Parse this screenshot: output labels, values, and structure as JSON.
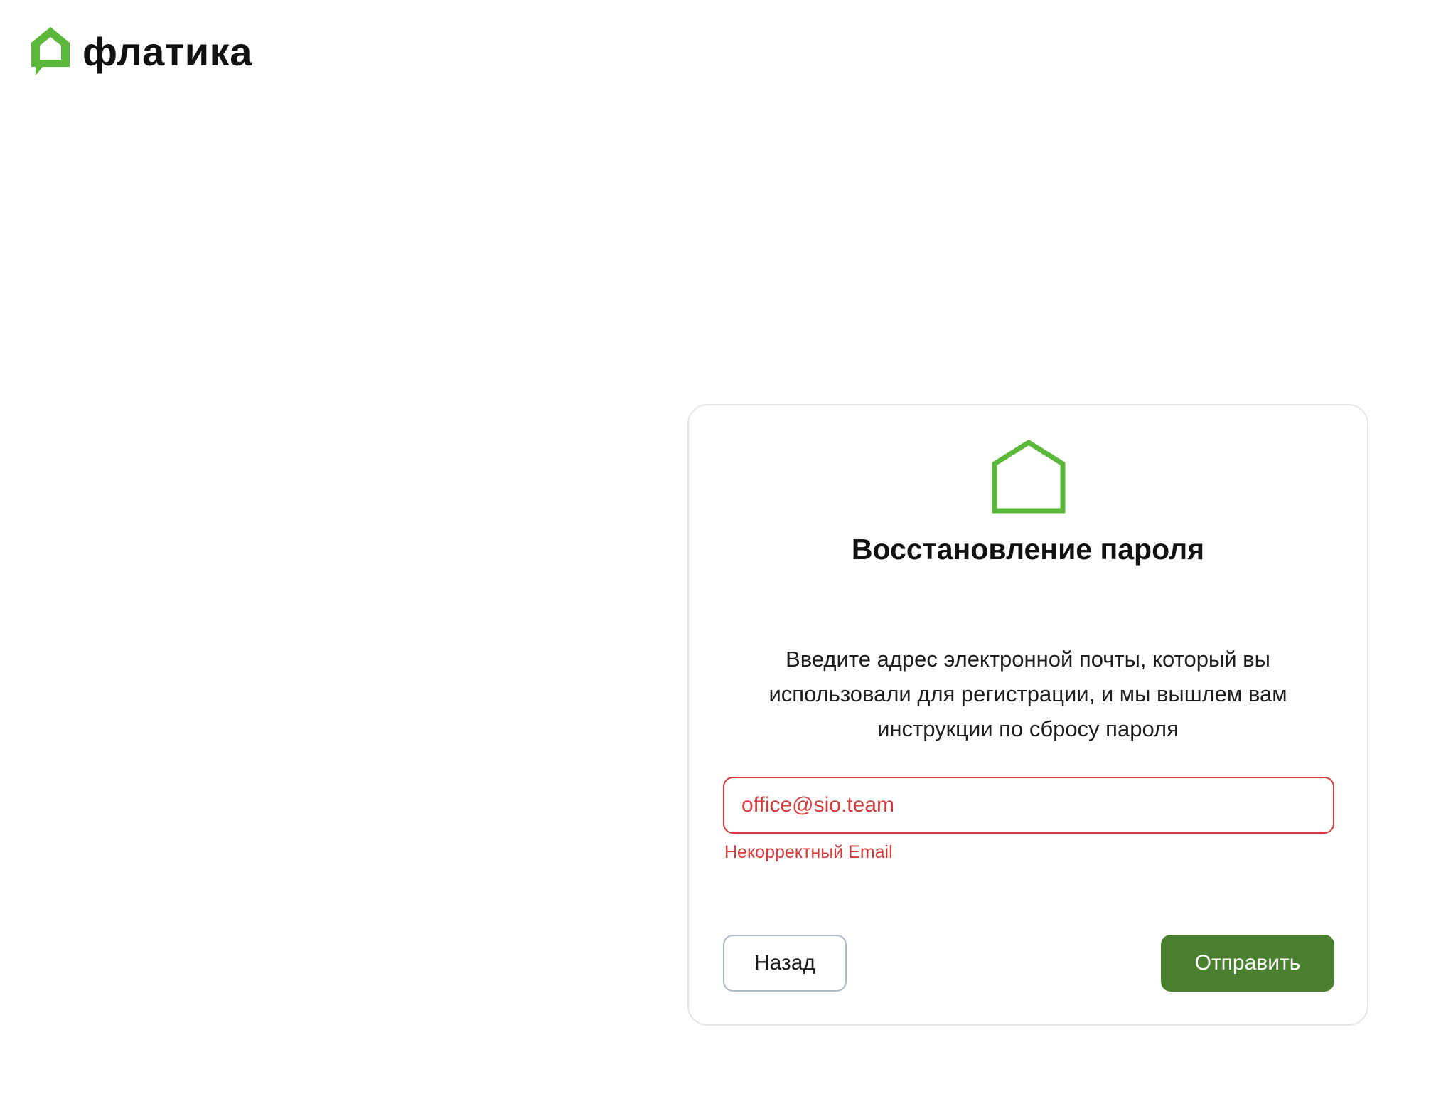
{
  "header": {
    "brand_name": "флатика",
    "logo_icon": "house-bubble-icon",
    "brand_color": "#5cb83a"
  },
  "card": {
    "icon": "house-outline-icon",
    "title": "Восстановление пароля",
    "description": "Введите адрес электронной почты, который вы использовали для регистрации, и мы вышлем вам инструкции по сбросу пароля",
    "email": {
      "value": "office@sio.team",
      "error": "Некорректный Email"
    },
    "buttons": {
      "back_label": "Назад",
      "submit_label": "Отправить"
    }
  },
  "colors": {
    "accent_green": "#5cb83a",
    "button_green": "#4a7f2f",
    "error_red": "#d43b3b",
    "border_gray": "#e3e6ea"
  }
}
